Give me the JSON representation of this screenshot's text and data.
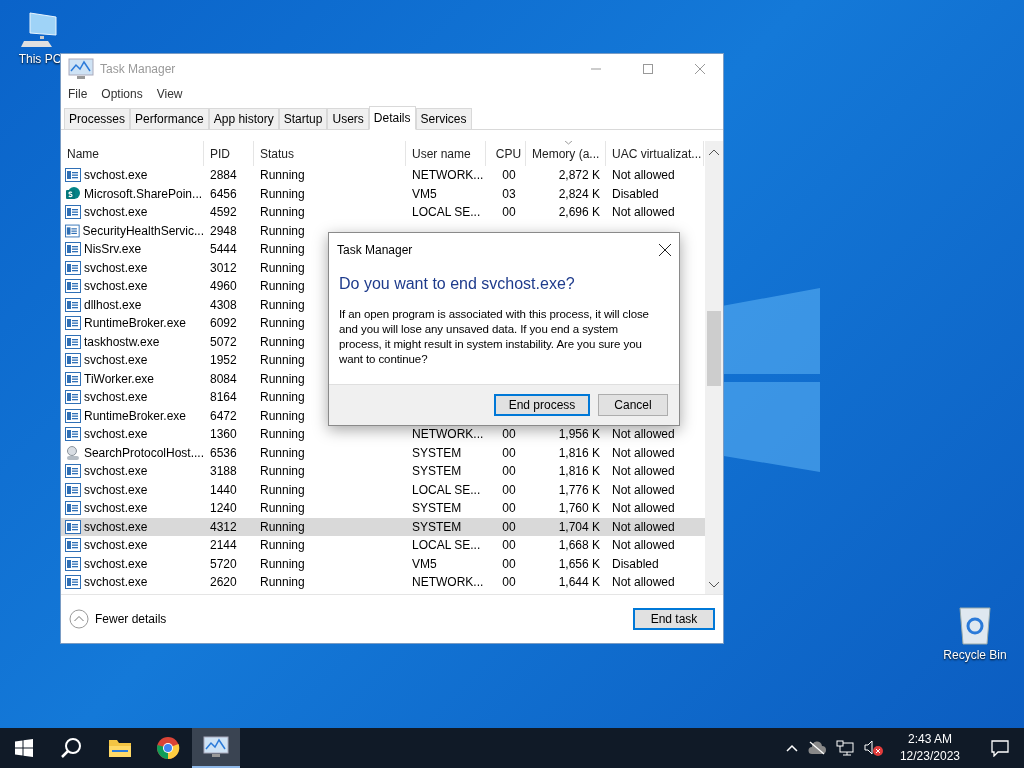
{
  "desktop_icons": [
    {
      "label": "This PC",
      "kind": "pc"
    },
    {
      "label": "Recycle Bin",
      "kind": "bin"
    }
  ],
  "window": {
    "title": "Task Manager",
    "menu": [
      "File",
      "Options",
      "View"
    ],
    "tabs": [
      {
        "label": "Processes",
        "selected": false
      },
      {
        "label": "Performance",
        "selected": false
      },
      {
        "label": "App history",
        "selected": false
      },
      {
        "label": "Startup",
        "selected": false
      },
      {
        "label": "Users",
        "selected": false
      },
      {
        "label": "Details",
        "selected": true
      },
      {
        "label": "Services",
        "selected": false
      }
    ],
    "table": {
      "columns": [
        "Name",
        "PID",
        "Status",
        "User name",
        "CPU",
        "Memory (a...",
        "UAC virtualizat..."
      ],
      "rows": [
        {
          "kind": "app",
          "name": "svchost.exe",
          "pid": "2884",
          "status": "Running",
          "user": "NETWORK...",
          "cpu": "00",
          "memory": "2,872 K",
          "uac": "Not allowed",
          "selected": false
        },
        {
          "kind": "sharepoint",
          "name": "Microsoft.SharePoin...",
          "pid": "6456",
          "status": "Running",
          "user": "VM5",
          "cpu": "03",
          "memory": "2,824 K",
          "uac": "Disabled",
          "selected": false
        },
        {
          "kind": "app",
          "name": "svchost.exe",
          "pid": "4592",
          "status": "Running",
          "user": "LOCAL SE...",
          "cpu": "00",
          "memory": "2,696 K",
          "uac": "Not allowed",
          "selected": false
        },
        {
          "kind": "app",
          "name": "SecurityHealthServic...",
          "pid": "2948",
          "status": "Running",
          "selected": false
        },
        {
          "kind": "app",
          "name": "NisSrv.exe",
          "pid": "5444",
          "status": "Running",
          "selected": false
        },
        {
          "kind": "app",
          "name": "svchost.exe",
          "pid": "3012",
          "status": "Running",
          "selected": false
        },
        {
          "kind": "app",
          "name": "svchost.exe",
          "pid": "4960",
          "status": "Running",
          "selected": false
        },
        {
          "kind": "app",
          "name": "dllhost.exe",
          "pid": "4308",
          "status": "Running",
          "selected": false
        },
        {
          "kind": "app",
          "name": "RuntimeBroker.exe",
          "pid": "6092",
          "status": "Running",
          "selected": false
        },
        {
          "kind": "app",
          "name": "taskhostw.exe",
          "pid": "5072",
          "status": "Running",
          "selected": false
        },
        {
          "kind": "app",
          "name": "svchost.exe",
          "pid": "1952",
          "status": "Running",
          "selected": false
        },
        {
          "kind": "app",
          "name": "TiWorker.exe",
          "pid": "8084",
          "status": "Running",
          "selected": false
        },
        {
          "kind": "app",
          "name": "svchost.exe",
          "pid": "8164",
          "status": "Running",
          "selected": false
        },
        {
          "kind": "app",
          "name": "RuntimeBroker.exe",
          "pid": "6472",
          "status": "Running",
          "selected": false
        },
        {
          "kind": "app",
          "name": "svchost.exe",
          "pid": "1360",
          "status": "Running",
          "user": "NETWORK...",
          "cpu": "00",
          "memory": "1,956 K",
          "uac": "Not allowed",
          "selected": false
        },
        {
          "kind": "search",
          "name": "SearchProtocolHost....",
          "pid": "6536",
          "status": "Running",
          "user": "SYSTEM",
          "cpu": "00",
          "memory": "1,816 K",
          "uac": "Not allowed",
          "selected": false
        },
        {
          "kind": "app",
          "name": "svchost.exe",
          "pid": "3188",
          "status": "Running",
          "user": "SYSTEM",
          "cpu": "00",
          "memory": "1,816 K",
          "uac": "Not allowed",
          "selected": false
        },
        {
          "kind": "app",
          "name": "svchost.exe",
          "pid": "1440",
          "status": "Running",
          "user": "LOCAL SE...",
          "cpu": "00",
          "memory": "1,776 K",
          "uac": "Not allowed",
          "selected": false
        },
        {
          "kind": "app",
          "name": "svchost.exe",
          "pid": "1240",
          "status": "Running",
          "user": "SYSTEM",
          "cpu": "00",
          "memory": "1,760 K",
          "uac": "Not allowed",
          "selected": false
        },
        {
          "kind": "app",
          "name": "svchost.exe",
          "pid": "4312",
          "status": "Running",
          "user": "SYSTEM",
          "cpu": "00",
          "memory": "1,704 K",
          "uac": "Not allowed",
          "selected": true
        },
        {
          "kind": "app",
          "name": "svchost.exe",
          "pid": "2144",
          "status": "Running",
          "user": "LOCAL SE...",
          "cpu": "00",
          "memory": "1,668 K",
          "uac": "Not allowed",
          "selected": false
        },
        {
          "kind": "app",
          "name": "svchost.exe",
          "pid": "5720",
          "status": "Running",
          "user": "VM5",
          "cpu": "00",
          "memory": "1,656 K",
          "uac": "Disabled",
          "selected": false
        },
        {
          "kind": "app",
          "name": "svchost.exe",
          "pid": "2620",
          "status": "Running",
          "user": "NETWORK...",
          "cpu": "00",
          "memory": "1,644 K",
          "uac": "Not allowed",
          "selected": false
        }
      ]
    },
    "footer": {
      "toggle": "Fewer details",
      "button": "End task"
    }
  },
  "dialog": {
    "title": "Task Manager",
    "heading": "Do you want to end svchost.exe?",
    "message": "If an open program is associated with this process, it will close and you will lose any unsaved data. If you end a system process, it might result in system instability. Are you sure you want to continue?",
    "buttons": [
      {
        "label": "End process",
        "kind": "default"
      },
      {
        "label": "Cancel",
        "kind": "normal"
      }
    ]
  },
  "taskbar": {
    "apps": [
      {
        "kind": "explorer",
        "active": false
      },
      {
        "kind": "chrome",
        "active": false
      },
      {
        "kind": "taskmgr",
        "active": true
      }
    ],
    "time": "2:43 AM",
    "date": "12/23/2023"
  }
}
